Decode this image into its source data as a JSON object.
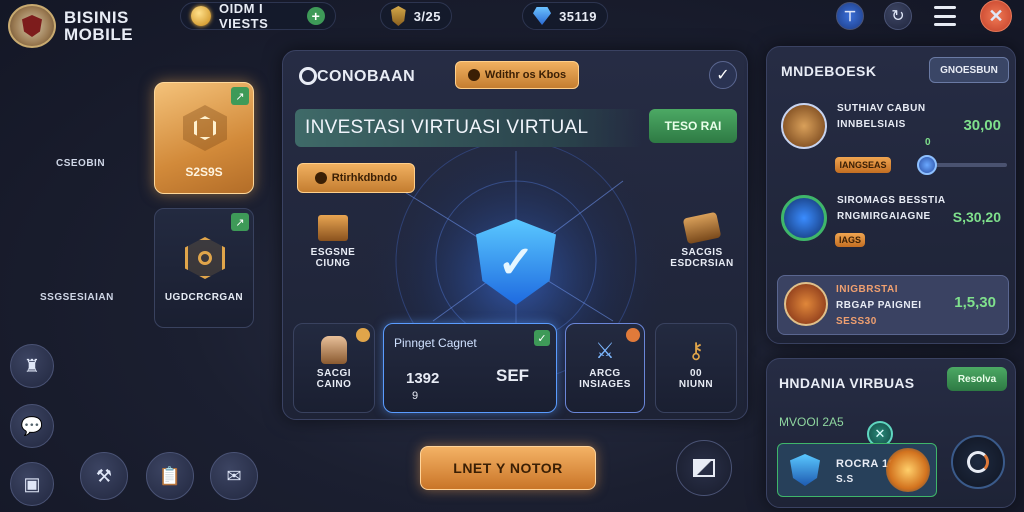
{
  "brand": {
    "line1": "BISINIS",
    "line2": "MOBILE",
    "logo_icon": "shield-emblem-icon"
  },
  "topbar": {
    "coins": "OIDM I VIESTS",
    "shield_value": "3/25",
    "gems_value": "35119"
  },
  "left_labels": {
    "label1": "CSEOBIN",
    "label2": "SSGSESIAIAN"
  },
  "left_cards": [
    {
      "value": "S2S9S",
      "icon": "shield-badge-icon"
    },
    {
      "value": "UGDCRCRGAN",
      "icon": "gear-shield-icon"
    }
  ],
  "main_panel": {
    "title": "CONOBAAN",
    "tag": "Wdithr os Kbos",
    "header_text": "INVESTASI VIRTUASI VIRTUAL",
    "header_button": "TESO RAI",
    "sub_tag": "Rtirhkdbndo",
    "left_item": {
      "line1": "ESGSNE",
      "line2": "CIUNG"
    },
    "right_item": {
      "line1": "SACGIS",
      "line2": "ESDCRSIAN"
    },
    "cards": [
      {
        "line1": "SACGI",
        "line2": "CAINO"
      },
      {
        "title": "Pinnget Cagnet",
        "value1": "1392",
        "value2": "SEF",
        "sub": "9"
      },
      {
        "line1": "ARCG",
        "line2": "INSIAGES"
      },
      {
        "line1": "00",
        "line2": "NIUNN"
      }
    ]
  },
  "bottom_button": "LNET Y NOTOR",
  "right_panel": {
    "title": "MNDEBOESK",
    "button": "GNOESBUN",
    "items": [
      {
        "line1": "SUTHIAV CABUN",
        "line2": "INNBELSIAIS",
        "value": "30,00",
        "tag": "IANGSEAS",
        "extra": "0"
      },
      {
        "line1": "SIROMAGS BESSTIA",
        "line2": "RNGMIRGAIAGNE",
        "value": "S,30,20",
        "tag": "IAGS"
      },
      {
        "line1": "INIGBRSTAI",
        "line2": "RBGAP PAIGNEI",
        "value": "1,5,30",
        "tag": "SESS30"
      }
    ]
  },
  "bottom_right_panel": {
    "title": "HNDANIA VIRBUAS",
    "button": "Resolva",
    "sub_label": "MVOOI 2A5",
    "card_line1": "ROCRA 1S,20",
    "card_line2": "S.S"
  },
  "colors": {
    "accent_gold": "#e0a54a",
    "accent_green": "#4ca964",
    "accent_blue": "#3d8cff",
    "close_red": "#e0553a"
  }
}
